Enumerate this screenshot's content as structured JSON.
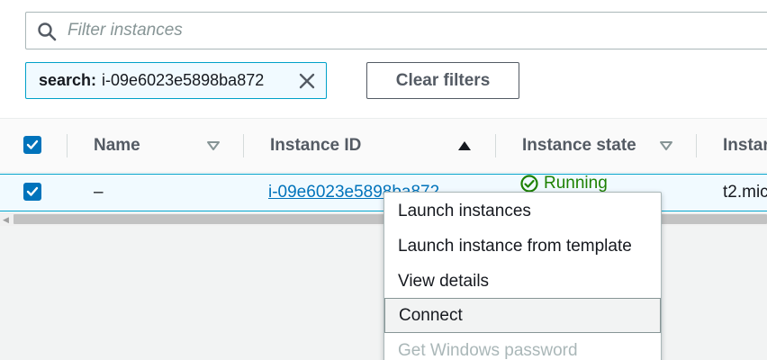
{
  "filter": {
    "placeholder": "Filter instances"
  },
  "token": {
    "key": "search:",
    "value": "i-09e6023e5898ba872"
  },
  "clear_filters_label": "Clear filters",
  "columns": [
    {
      "label": "Name",
      "sort": "none"
    },
    {
      "label": "Instance ID",
      "sort": "ascending"
    },
    {
      "label": "Instance state",
      "sort": "none"
    },
    {
      "label": "Instar"
    }
  ],
  "row": {
    "selected": true,
    "name": "–",
    "instance_id": "i-09e6023e5898ba872",
    "state": "Running",
    "instance_type": "t2.mic"
  },
  "context_menu": [
    {
      "label": "Launch instances",
      "disabled": false
    },
    {
      "label": "Launch instance from template",
      "disabled": false
    },
    {
      "label": "View details",
      "disabled": false
    },
    {
      "label": "Connect",
      "disabled": false,
      "hovered": true
    },
    {
      "label": "Get Windows password",
      "disabled": true
    }
  ],
  "colors": {
    "accent_blue": "#0073bb",
    "selection_border": "#00a1c9",
    "selection_bg": "#f1faff",
    "running_green": "#1d8102"
  }
}
